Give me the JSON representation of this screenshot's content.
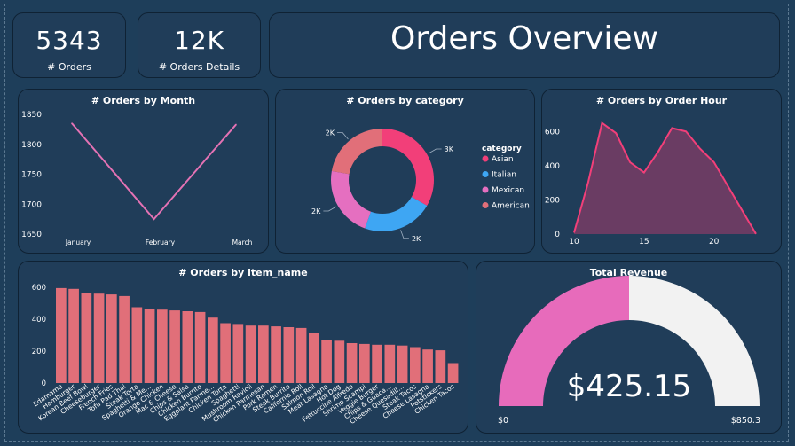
{
  "kpis": {
    "orders_value": "5343",
    "orders_label": "# Orders",
    "details_value": "12K",
    "details_label": "# Orders Details"
  },
  "header": {
    "title": "Orders Overview"
  },
  "charts": {
    "month_title": "# Orders by Month",
    "category_title": "# Orders by category",
    "hour_title": "# Orders by Order Hour",
    "item_title": "# Orders by item_name",
    "revenue_title": "Total Revenue"
  },
  "revenue": {
    "value": "$425.15",
    "min_label": "$0",
    "max_label": "$850.3"
  },
  "colors": {
    "line": "#e472b4",
    "asian": "#f23f79",
    "italian": "#3ea6f3",
    "mexican": "#e56fc0",
    "american": "#e16f79",
    "bar": "#e16f79",
    "area_fill": "#6a3c63",
    "area_line": "#f23f79",
    "gauge_fill": "#e76bbb",
    "gauge_bg": "#f2f2f2"
  },
  "chart_data": [
    {
      "type": "line",
      "title": "# Orders by Month",
      "categories": [
        "January",
        "February",
        "March"
      ],
      "values": [
        1835,
        1675,
        1833
      ],
      "yticks": [
        "1650",
        "1700",
        "1750",
        "1800",
        "1850"
      ],
      "ylim": [
        1650,
        1850
      ]
    },
    {
      "type": "pie",
      "title": "# Orders by category",
      "legend_title": "category",
      "labels": [
        "Asian",
        "Italian",
        "Mexican",
        "American"
      ],
      "values": [
        3000,
        2000,
        2000,
        2000
      ],
      "data_labels": [
        "3K",
        "2K",
        "2K",
        "2K"
      ]
    },
    {
      "type": "area",
      "title": "# Orders by Order Hour",
      "x": [
        10,
        11,
        12,
        13,
        14,
        15,
        16,
        17,
        18,
        19,
        20,
        21,
        22,
        23
      ],
      "values": [
        8,
        300,
        650,
        590,
        420,
        360,
        480,
        620,
        600,
        500,
        420,
        280,
        140,
        1
      ],
      "xticks": [
        "10",
        "15",
        "20"
      ],
      "yticks": [
        "0",
        "200",
        "400",
        "600"
      ],
      "ylim": [
        0,
        700
      ]
    },
    {
      "type": "bar",
      "title": "# Orders by item_name",
      "categories": [
        "Edamame",
        "Hamburger",
        "Korean Beef Bowl",
        "Cheeseburger",
        "French Fries",
        "Tofu Pad Thai",
        "Steak Torta",
        "Spaghetti & Me...",
        "Orange Chicken",
        "Mac & Cheese",
        "Chips & Salsa",
        "Chicken Burrito",
        "Eggplant Parme...",
        "Chicken Torta",
        "Spaghetti",
        "Mushroom Ravioli",
        "Chicken Parmesan",
        "Pork Ramen",
        "Steak Burrito",
        "California Roll",
        "Salmon Roll",
        "Meat Lasagna",
        "Hot Dog",
        "Fettuccine Alfredo",
        "Shrimp Scampi",
        "Veggie Burger",
        "Chips & Guaca...",
        "Cheese Quesadill...",
        "Steak Tacos",
        "Cheese Lasagna",
        "Potstickers",
        "Chicken Tacos"
      ],
      "values": [
        595,
        590,
        565,
        560,
        555,
        545,
        475,
        465,
        460,
        455,
        450,
        445,
        410,
        375,
        370,
        360,
        360,
        355,
        350,
        345,
        315,
        270,
        265,
        250,
        245,
        240,
        240,
        235,
        225,
        210,
        205,
        125
      ],
      "yticks": [
        "0",
        "200",
        "400",
        "600"
      ],
      "ylim": [
        0,
        650
      ]
    },
    {
      "type": "gauge",
      "title": "Total Revenue",
      "value": 425.15,
      "min": 0,
      "max": 850.3
    }
  ]
}
